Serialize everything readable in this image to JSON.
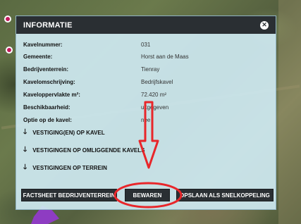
{
  "panel": {
    "title": "INFORMATIE",
    "close_icon": "close-icon"
  },
  "details": [
    {
      "key": "Kavelnummer:",
      "value": "031"
    },
    {
      "key": "Gemeente:",
      "value": "Horst aan de Maas"
    },
    {
      "key": "Bedrijventerrein:",
      "value": "Tienray"
    },
    {
      "key": "Kavelomschrijving:",
      "value": "Bedrijfskavel"
    },
    {
      "key": "Kaveloppervlakte m²:",
      "value": "72.420 m²"
    },
    {
      "key": "Beschikbaarheid:",
      "value": "uitgegeven"
    },
    {
      "key": "Optie op de kavel:",
      "value": "nee"
    }
  ],
  "sections": [
    "VESTIGING(EN) OP KAVEL",
    "VESTIGINGEN OP OMLIGGENDE KAVELS",
    "VESTIGINGEN OP TERREIN"
  ],
  "buttons": {
    "factsheet": "FACTSHEET BEDRIJVENTERREIN",
    "save": "BEWAREN",
    "shortcut": "OPSLAAN ALS SNELKOPPELING"
  },
  "colors": {
    "panel_bg": "#cde8f0",
    "header_bg": "#2a2f33",
    "annotation_red": "#e8262a"
  }
}
